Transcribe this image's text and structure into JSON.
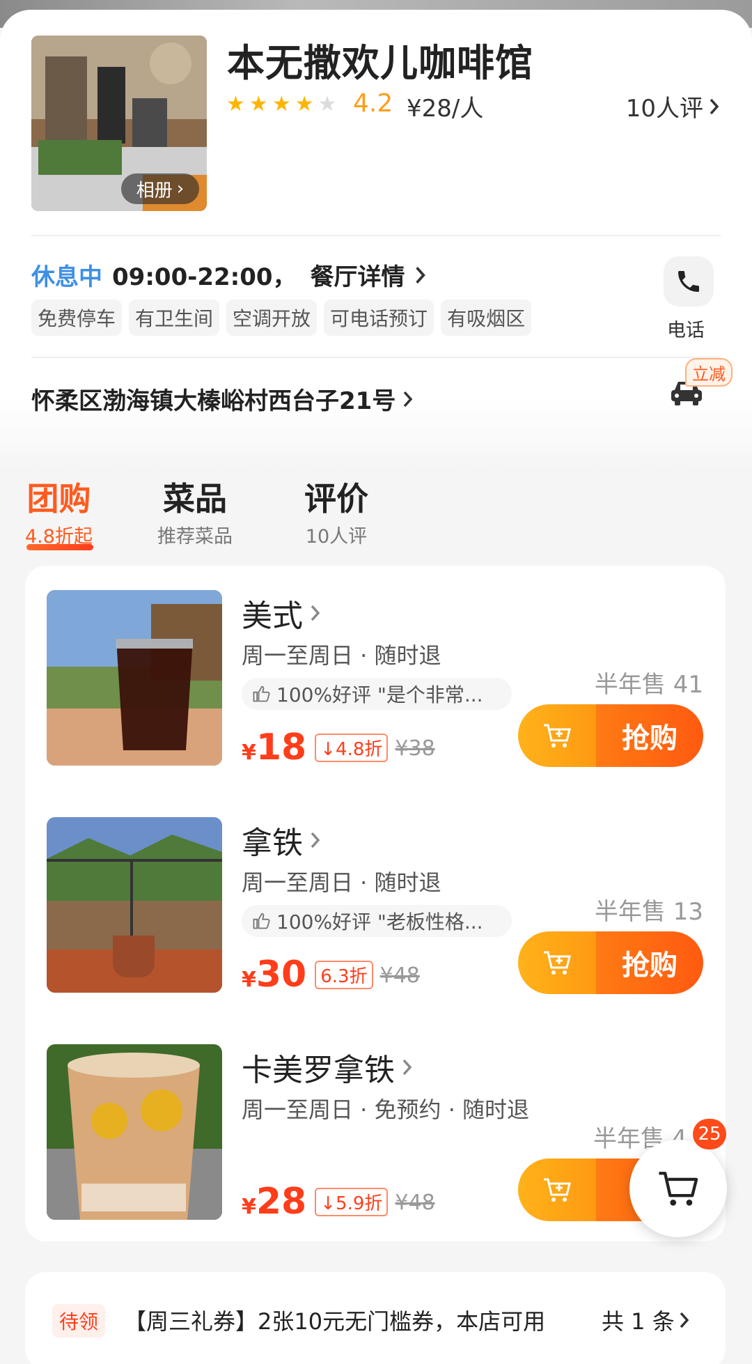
{
  "shop": {
    "name": "本无撒欢儿咖啡馆",
    "rating": "4.2",
    "price_per_person": "¥28/人",
    "review_count": "10人评",
    "album_label": "相册",
    "star_icon": "star-icon"
  },
  "info": {
    "status": "休息中",
    "hours": "09:00-22:00，",
    "detail_link": "餐厅详情",
    "tags": [
      "免费停车",
      "有卫生间",
      "空调开放",
      "可电话预订",
      "有吸烟区"
    ],
    "phone_label": "电话",
    "address": "怀柔区渤海镇大榛峪村西台子21号",
    "discount_badge": "立减"
  },
  "tabs": [
    {
      "title": "团购",
      "subtitle": "4.8折起",
      "active": true
    },
    {
      "title": "菜品",
      "subtitle": "推荐菜品",
      "active": false
    },
    {
      "title": "评价",
      "subtitle": "10人评",
      "active": false
    }
  ],
  "deals": [
    {
      "title": "美式",
      "terms": "周一至周日 · 随时退",
      "praise": "100%好评 \"是个非常...",
      "yen": "¥",
      "price": "18",
      "discount": "4.8折",
      "original": "¥38",
      "sold": "半年售 41",
      "buy_label": "抢购"
    },
    {
      "title": "拿铁",
      "terms": "周一至周日 · 随时退",
      "praise": "100%好评 \"老板性格...",
      "yen": "¥",
      "price": "30",
      "discount": "6.3折",
      "original": "¥48",
      "sold": "半年售 13",
      "buy_label": "抢购"
    },
    {
      "title": "卡美罗拿铁",
      "terms": "周一至周日 · 免预约 · 随时退",
      "praise": "",
      "yen": "¥",
      "price": "28",
      "discount": "5.9折",
      "original": "¥48",
      "sold": "半年售 4",
      "buy_label": "抢"
    }
  ],
  "cart": {
    "count": "25"
  },
  "coupon": {
    "badge": "待领",
    "text": "【周三礼券】2张10元无门槛券，本店可用",
    "count": "共 1 条"
  },
  "colors": {
    "accent": "#ff5a1f",
    "price_red": "#ff3d1a",
    "status_blue": "#3d8fe6",
    "star": "#ffb400"
  }
}
